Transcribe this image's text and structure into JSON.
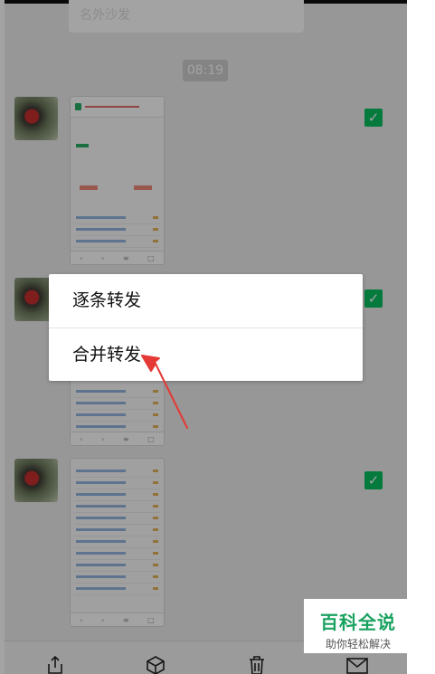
{
  "chat": {
    "time": "08:19",
    "preview_bubble_text": "名外沙发"
  },
  "messages": [
    {
      "checked": true,
      "check_glyph": "✓"
    },
    {
      "checked": true,
      "check_glyph": "✓"
    },
    {
      "checked": true,
      "check_glyph": "✓"
    }
  ],
  "forward_menu": {
    "one_by_one": "逐条转发",
    "merge": "合并转发"
  },
  "toolbar": {
    "share_icon": "share-icon",
    "favorite_icon": "favorite-box-icon",
    "delete_icon": "trash-icon",
    "mail_icon": "mail-icon"
  },
  "watermark": {
    "title": "百科全说",
    "subtitle": "助你轻松解决"
  },
  "colors": {
    "accent_green": "#07c160",
    "arrow_red": "#e53935"
  }
}
